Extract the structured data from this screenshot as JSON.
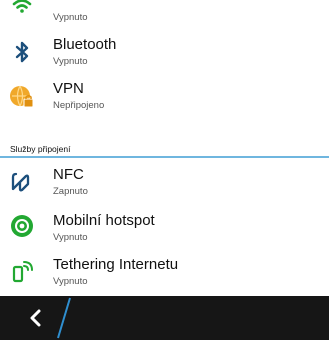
{
  "items": [
    {
      "title": "",
      "subtitle": "Vypnuto",
      "icon": "wifi-icon"
    },
    {
      "title": "Bluetooth",
      "subtitle": "Vypnuto",
      "icon": "bluetooth-icon"
    },
    {
      "title": "VPN",
      "subtitle": "Nepřipojeno",
      "icon": "vpn-globe-icon"
    }
  ],
  "section": {
    "label": "Služby připojení"
  },
  "services": [
    {
      "title": "NFC",
      "subtitle": "Zapnuto",
      "icon": "nfc-icon"
    },
    {
      "title": "Mobilní hotspot",
      "subtitle": "Vypnuto",
      "icon": "hotspot-icon"
    },
    {
      "title": "Tethering Internetu",
      "subtitle": "Vypnuto",
      "icon": "tethering-icon"
    }
  ],
  "colors": {
    "accent": "#6fb6df",
    "green": "#22a832",
    "vpn": "#f0a82a",
    "bar": "#161616"
  }
}
